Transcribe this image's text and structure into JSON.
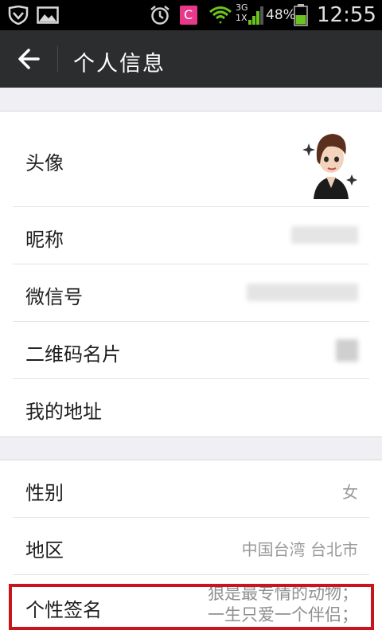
{
  "status_bar": {
    "network": "3G\n1X",
    "battery_percent": "48%",
    "time": "12:55",
    "app_badge": "C",
    "icons": [
      "shield-icon",
      "gallery-icon",
      "alarm-icon",
      "app-c-icon",
      "wifi-icon",
      "signal-icon",
      "battery-icon"
    ]
  },
  "header": {
    "title": "个人信息",
    "back_icon": "arrow-left-icon"
  },
  "profile": {
    "avatar_label": "头像",
    "nickname_label": "昵称",
    "wechat_id_label": "微信号",
    "qr_label": "二维码名片",
    "address_label": "我的地址"
  },
  "details": {
    "gender_label": "性别",
    "gender_value": "女",
    "region_label": "地区",
    "region_value": "中国台湾 台北市",
    "signature_label": "个性签名",
    "signature_line1": "狼是最专情的动物；",
    "signature_line2": "一生只爱一个伴侣；"
  },
  "colors": {
    "header_bg": "#2b2d2f",
    "highlight": "#c8141c",
    "page_bg": "#efeff4"
  }
}
